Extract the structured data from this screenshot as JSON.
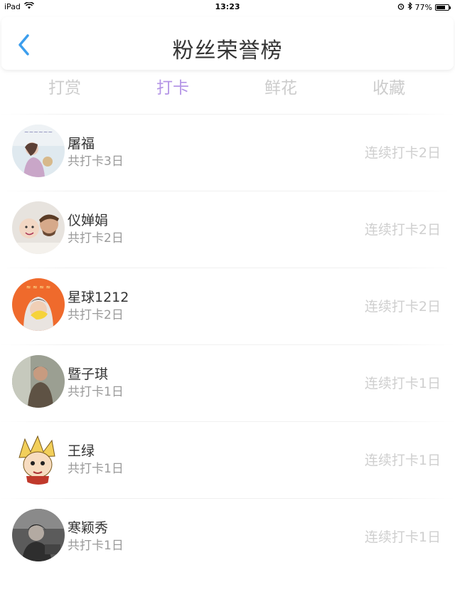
{
  "status_bar": {
    "device": "iPad",
    "time": "13:23",
    "battery": "77%",
    "battery_level": 0.77
  },
  "header": {
    "title": "粉丝荣誉榜",
    "back_icon": "chevron-left-icon",
    "accent_color": "#3c9eed"
  },
  "tabs": [
    {
      "label": "打赏"
    },
    {
      "label": "打卡"
    },
    {
      "label": "鲜花"
    },
    {
      "label": "收藏"
    }
  ],
  "active_tab": "打卡",
  "active_color": "#b495e6",
  "users": [
    {
      "name": "屠福",
      "total": "共打卡3日",
      "streak": "连续打卡2日"
    },
    {
      "name": "仪婵娟",
      "total": "共打卡2日",
      "streak": "连续打卡2日"
    },
    {
      "name": "星球1212",
      "total": "共打卡2日",
      "streak": "连续打卡2日"
    },
    {
      "name": "暨子琪",
      "total": "共打卡1日",
      "streak": "连续打卡1日"
    },
    {
      "name": "王绿",
      "total": "共打卡1日",
      "streak": "连续打卡1日"
    },
    {
      "name": "寒颖秀",
      "total": "共打卡1日",
      "streak": "连续打卡1日"
    }
  ]
}
